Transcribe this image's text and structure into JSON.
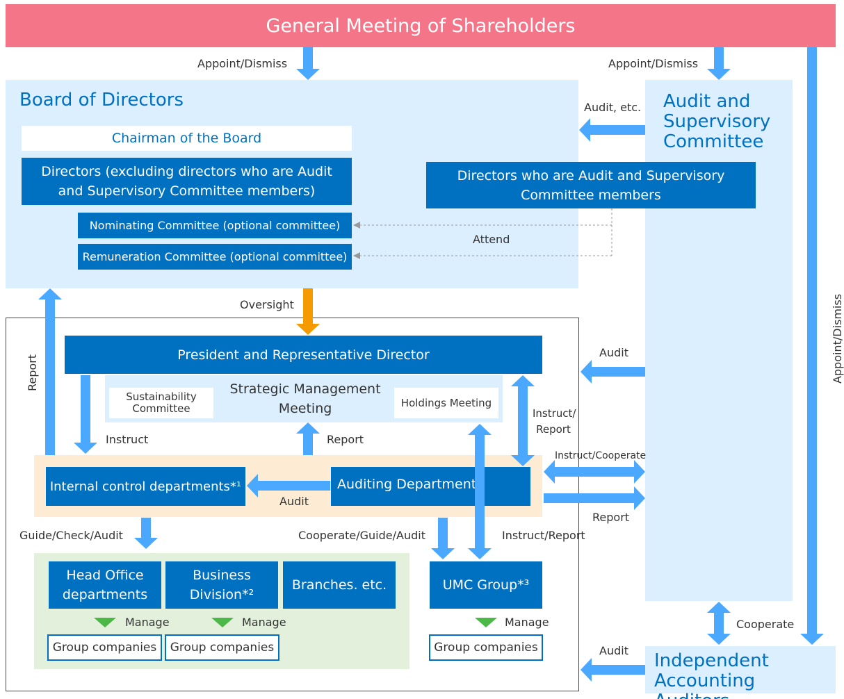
{
  "colors": {
    "shareholders": "#f47588",
    "panel": "#dcefff",
    "box": "#0071c1",
    "arrow": "#4aa8ff",
    "oversight": "#f59a00",
    "internal": "#fdebd3",
    "divisions": "#e2f0dc",
    "manage": "#4cb848"
  },
  "shareholders": "General Meeting of Shareholders",
  "board": {
    "title": "Board of Directors",
    "chairman": "Chairman of the Board",
    "directors": "Directors (excluding directors who are Audit and Supervisory Committee members)",
    "nominating": "Nominating Committee (optional committee)",
    "remuneration": "Remuneration Committee (optional committee)"
  },
  "audit_committee": {
    "title": "Audit and Supervisory Committee",
    "members": "Directors who are Audit and Supervisory Committee members"
  },
  "executive": {
    "president": "President and Representative Director",
    "strategic": "Strategic Management Meeting",
    "sustainability": "Sustainability Committee",
    "holdings": "Holdings Meeting",
    "internal_control": "Internal control departments*¹",
    "auditing": "Auditing Department",
    "head_office": "Head Office departments",
    "business": "Business Division*²",
    "branches": "Branches. etc.",
    "umc": "UMC Group*³",
    "group_companies": "Group companies",
    "manage": "Manage"
  },
  "auditors": "Independent Accounting Auditors",
  "labels": {
    "appoint_dismiss": "Appoint/Dismiss",
    "audit_etc": "Audit, etc.",
    "attend": "Attend",
    "oversight": "Oversight",
    "report": "Report",
    "audit": "Audit",
    "instruct": "Instruct",
    "instruct_report": "Instruct/ Report",
    "instruct_cooperate": "Instruct/Cooperate",
    "guide_check_audit": "Guide/Check/Audit",
    "cooperate_guide_audit": "Cooperate/Guide/Audit",
    "instruct_report2": "Instruct/Report",
    "cooperate": "Cooperate"
  }
}
